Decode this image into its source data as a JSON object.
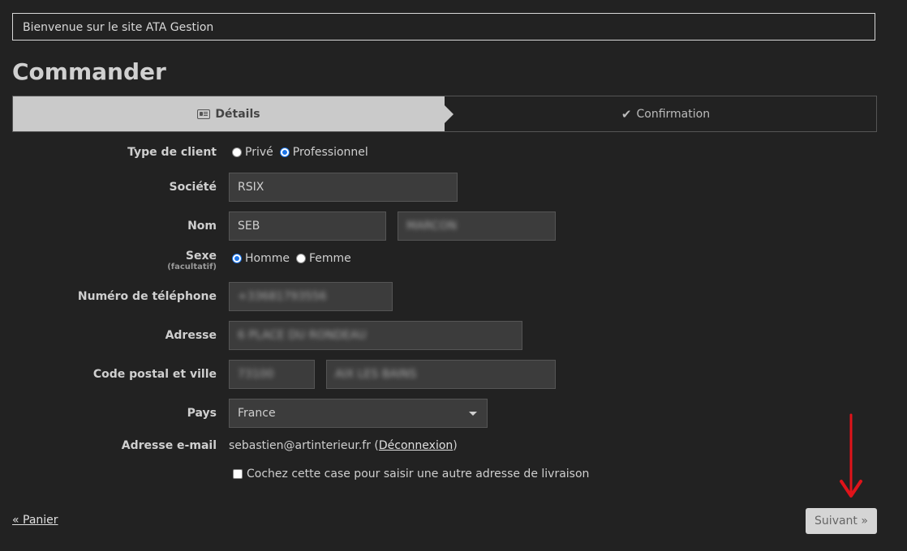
{
  "welcome": "Bienvenue sur le site ATA Gestion",
  "title": "Commander",
  "steps": {
    "details": "Détails",
    "confirmation": "Confirmation"
  },
  "form": {
    "client_type": {
      "label": "Type de client",
      "options": [
        "Privé",
        "Professionnel"
      ],
      "selected": "Professionnel"
    },
    "societe": {
      "label": "Société",
      "value": "RSIX"
    },
    "nom": {
      "label": "Nom",
      "first": "SEB",
      "last": "MARCON"
    },
    "sexe": {
      "label": "Sexe",
      "sublabel": "(facultatif)",
      "options": [
        "Homme",
        "Femme"
      ],
      "selected": "Homme"
    },
    "telephone": {
      "label": "Numéro de téléphone",
      "value": "+33681793556"
    },
    "adresse": {
      "label": "Adresse",
      "value": "6 PLACE DU RONDEAU"
    },
    "code_postal_ville": {
      "label": "Code postal et ville",
      "cp": "73100",
      "ville": "AIX LES BAINS"
    },
    "pays": {
      "label": "Pays",
      "value": "France"
    },
    "email": {
      "label": "Adresse e-mail",
      "value": "sebastien@artinterieur.fr",
      "open_paren": "(",
      "logout": "Déconnexion",
      "close_paren": ")"
    },
    "delivery_checkbox": "Cochez cette case pour saisir une autre adresse de livraison"
  },
  "nav": {
    "back": "« Panier",
    "next": "Suivant »"
  },
  "colors": {
    "background": "#222222",
    "annotation_arrow": "#e0131a",
    "radio_accent": "#1a73e8"
  }
}
